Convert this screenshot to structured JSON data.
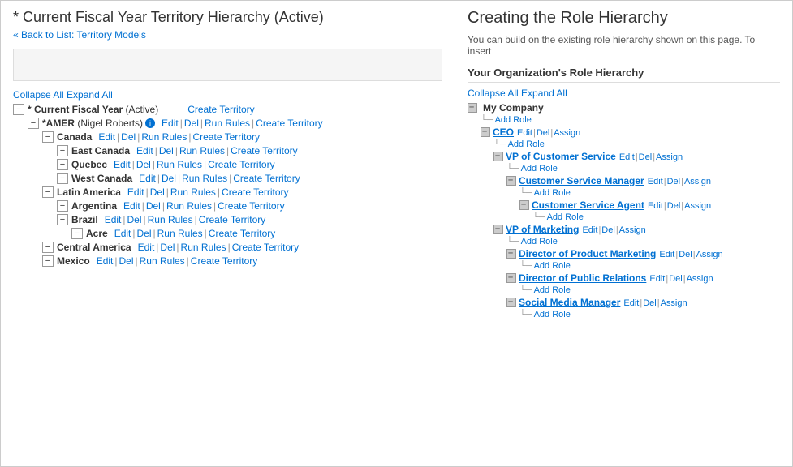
{
  "left": {
    "title": "* Current Fiscal Year Territory Hierarchy (Active)",
    "backLabel": "« Back to List: Territory Models",
    "collapseLabel": "Collapse All",
    "expandLabel": "Expand All",
    "tree": [
      {
        "id": "root",
        "indent": 0,
        "toggle": "-",
        "name": "* Current Fiscal Year",
        "suffix": "(Active)",
        "showActions": false,
        "createTerritory": "Create Territory",
        "indentClass": "indent-0"
      },
      {
        "id": "amer",
        "indent": 1,
        "toggle": "-",
        "name": "*AMER",
        "suffix": "(Nigel Roberts)",
        "hasInfo": true,
        "showActions": true,
        "createTerritory": "Create Territory",
        "indentClass": "indent-1"
      },
      {
        "id": "canada",
        "indent": 2,
        "toggle": "-",
        "name": "Canada",
        "suffix": "",
        "showActions": true,
        "createTerritory": "Create Territory",
        "indentClass": "indent-2"
      },
      {
        "id": "east-canada",
        "indent": 3,
        "toggle": "-",
        "name": "East Canada",
        "suffix": "",
        "showActions": true,
        "createTerritory": "Create Territory",
        "indentClass": "indent-3"
      },
      {
        "id": "quebec",
        "indent": 3,
        "toggle": "-",
        "name": "Quebec",
        "suffix": "",
        "showActions": true,
        "createTerritory": "Create Territory",
        "indentClass": "indent-3"
      },
      {
        "id": "west-canada",
        "indent": 3,
        "toggle": "-",
        "name": "West Canada",
        "suffix": "",
        "showActions": true,
        "createTerritory": "Create Territory",
        "indentClass": "indent-3"
      },
      {
        "id": "latin-america",
        "indent": 2,
        "toggle": "-",
        "name": "Latin America",
        "suffix": "",
        "showActions": true,
        "createTerritory": "Create Territory",
        "indentClass": "indent-2"
      },
      {
        "id": "argentina",
        "indent": 3,
        "toggle": "-",
        "name": "Argentina",
        "suffix": "",
        "showActions": true,
        "createTerritory": "Create Territory",
        "indentClass": "indent-3"
      },
      {
        "id": "brazil",
        "indent": 3,
        "toggle": "-",
        "name": "Brazil",
        "suffix": "",
        "showActions": true,
        "createTerritory": "Create Territory",
        "indentClass": "indent-3"
      },
      {
        "id": "acre",
        "indent": 4,
        "toggle": "-",
        "name": "Acre",
        "suffix": "",
        "showActions": true,
        "createTerritory": "Create Territory",
        "indentClass": "indent-4"
      },
      {
        "id": "central-america",
        "indent": 2,
        "toggle": "-",
        "name": "Central America",
        "suffix": "",
        "showActions": true,
        "createTerritory": "Create Territory",
        "indentClass": "indent-2"
      },
      {
        "id": "mexico",
        "indent": 2,
        "toggle": "-",
        "name": "Mexico",
        "suffix": "",
        "showActions": true,
        "createTerritory": "Create Territory",
        "indentClass": "indent-2"
      }
    ]
  },
  "right": {
    "title": "Creating the Role Hierarchy",
    "description": "You can build on the existing role hierarchy shown on this page. To insert",
    "sectionTitle": "Your Organization's Role Hierarchy",
    "collapseLabel": "Collapse All",
    "expandLabel": "Expand All",
    "roles": [
      {
        "id": "my-company",
        "type": "company",
        "name": "My Company",
        "indent": 0,
        "indentClass": "r-indent-0"
      },
      {
        "id": "add-role-1",
        "type": "add",
        "label": "Add Role",
        "indent": 1,
        "indentClass": "r-indent-1"
      },
      {
        "id": "ceo",
        "type": "role",
        "name": "CEO",
        "indent": 1,
        "indentClass": "r-indent-1"
      },
      {
        "id": "add-role-2",
        "type": "add",
        "label": "Add Role",
        "indent": 2,
        "indentClass": "r-indent-2"
      },
      {
        "id": "vp-customer",
        "type": "role",
        "name": "VP of Customer Service",
        "indent": 2,
        "indentClass": "r-indent-2"
      },
      {
        "id": "add-role-3",
        "type": "add",
        "label": "Add Role",
        "indent": 3,
        "indentClass": "r-indent-3"
      },
      {
        "id": "customer-service-manager",
        "type": "role",
        "name": "Customer Service Manager",
        "indent": 3,
        "indentClass": "r-indent-3"
      },
      {
        "id": "add-role-4",
        "type": "add",
        "label": "Add Role",
        "indent": 4,
        "indentClass": "r-indent-4"
      },
      {
        "id": "customer-service-agent",
        "type": "role",
        "name": "Customer Service Agent",
        "indent": 4,
        "indentClass": "r-indent-4"
      },
      {
        "id": "add-role-5",
        "type": "add",
        "label": "Add Role",
        "indent": 5,
        "indentClass": "r-indent-5"
      },
      {
        "id": "vp-marketing",
        "type": "role",
        "name": "VP of Marketing",
        "indent": 2,
        "indentClass": "r-indent-2"
      },
      {
        "id": "add-role-6",
        "type": "add",
        "label": "Add Role",
        "indent": 3,
        "indentClass": "r-indent-3"
      },
      {
        "id": "director-product-marketing",
        "type": "role",
        "name": "Director of Product Marketing",
        "indent": 3,
        "indentClass": "r-indent-3"
      },
      {
        "id": "add-role-7",
        "type": "add",
        "label": "Add Role",
        "indent": 4,
        "indentClass": "r-indent-4"
      },
      {
        "id": "director-public-relations",
        "type": "role",
        "name": "Director of Public Relations",
        "indent": 3,
        "indentClass": "r-indent-3"
      },
      {
        "id": "add-role-8",
        "type": "add",
        "label": "Add Role",
        "indent": 4,
        "indentClass": "r-indent-4"
      },
      {
        "id": "social-media-manager",
        "type": "role",
        "name": "Social Media Manager",
        "indent": 3,
        "indentClass": "r-indent-3"
      },
      {
        "id": "add-role-9",
        "type": "add",
        "label": "Add Role",
        "indent": 4,
        "indentClass": "r-indent-4"
      }
    ],
    "actions": {
      "edit": "Edit",
      "del": "Del",
      "assign": "Assign"
    }
  }
}
